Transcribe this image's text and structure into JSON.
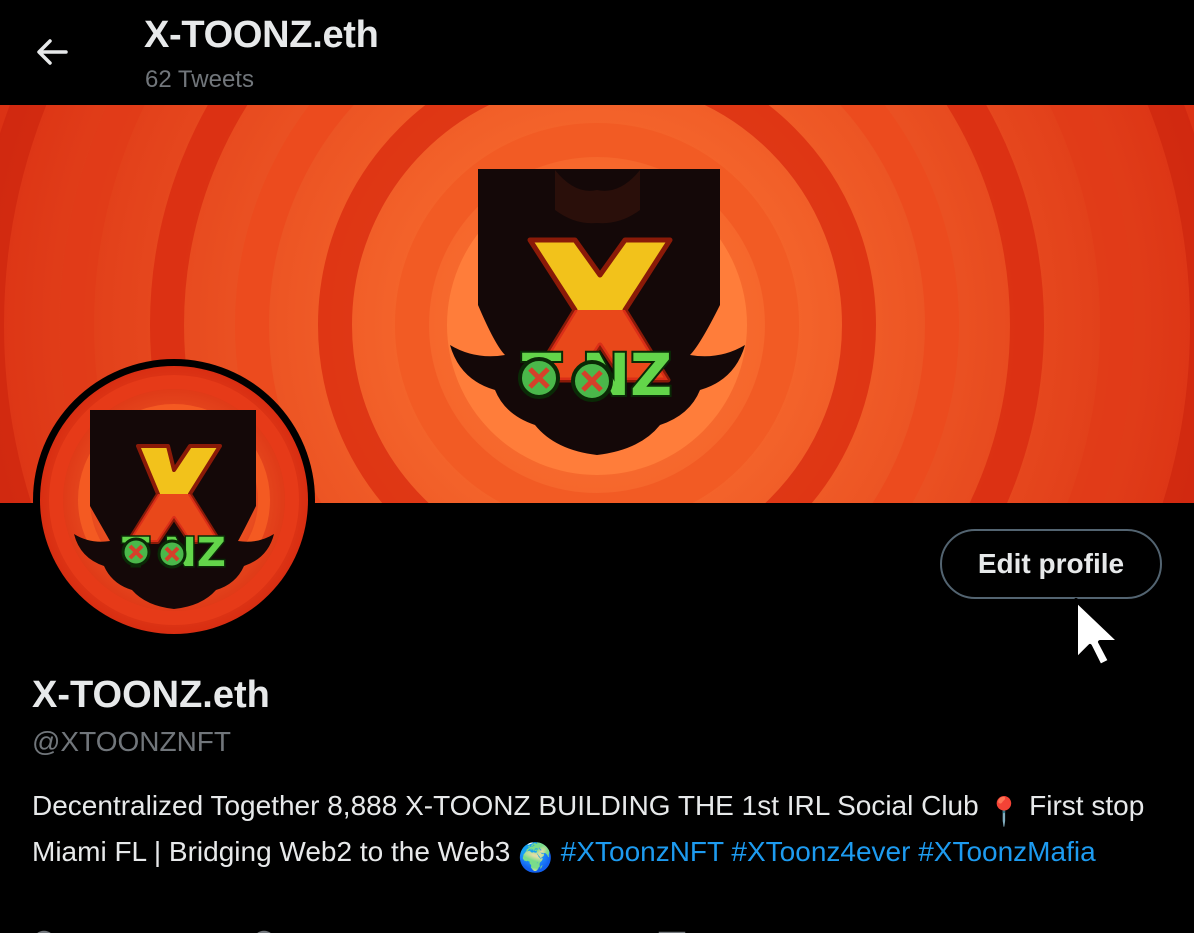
{
  "header": {
    "title": "X-TOONZ.eth",
    "tweet_count": "62 Tweets"
  },
  "banner": {
    "logo_word": "TOONZ",
    "logo_letter": "X",
    "colors": {
      "ring_outer": "#e8371b",
      "ring_inner": "#ff6a2e",
      "logo_x": "#f2c21b",
      "logo_text": "#63d54a"
    }
  },
  "profile": {
    "display_name": "X-TOONZ.eth",
    "handle": "@XTOONZNFT",
    "edit_label": "Edit profile",
    "bio": {
      "text_1": "Decentralized Together 8,888 X-TOONZ BUILDING THE 1st IRL Social Club ",
      "pin_emoji": "📍",
      "text_2": " First stop Miami FL | Bridging Web2 to the Web3 ",
      "globe_emoji": "🌍",
      "hashtags": [
        "#XToonzNFT",
        "#XToonz4ever",
        "#XToonzMafia"
      ]
    }
  },
  "theme": {
    "link_color": "#1d9bf0",
    "muted_text": "#71767b",
    "background": "#000000"
  }
}
